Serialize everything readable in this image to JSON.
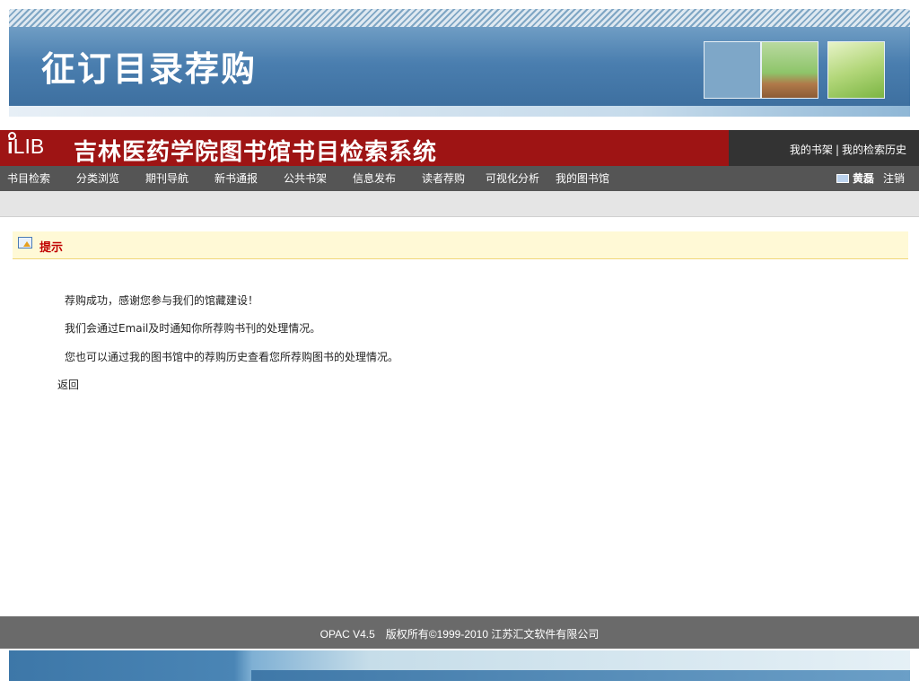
{
  "slide": {
    "title": "征订目录荐购"
  },
  "header": {
    "logo_i": "i",
    "logo_rest": "LIB",
    "site_title": "吉林医药学院图书馆书目检索系统",
    "links": [
      "我的书架",
      "我的检索历史"
    ],
    "link_separator": "|"
  },
  "nav": {
    "items": [
      "书目检索",
      "分类浏览",
      "期刊导航",
      "新书通报",
      "公共书架",
      "信息发布",
      "读者荐购",
      "可视化分析",
      "我的图书馆"
    ],
    "user_name": "黄磊",
    "logout_label": "注销"
  },
  "notice": {
    "title": "提示"
  },
  "messages": {
    "line1": "荐购成功，感谢您参与我们的馆藏建设！",
    "line2": "我们会通过Email及时通知你所荐购书刊的处理情况。",
    "line3": "您也可以通过我的图书馆中的荐购历史查看您所荐购图书的处理情况。",
    "back_label": "返回"
  },
  "footer": {
    "version": "OPAC V4.5",
    "copyright": "版权所有©1999-2010 江苏汇文软件有限公司"
  },
  "colors": {
    "header_red": "#9e1414",
    "nav_gray": "#555555",
    "notice_bg": "#fff9d6",
    "notice_title": "#c00000",
    "banner_blue": "#4a7eaf"
  }
}
